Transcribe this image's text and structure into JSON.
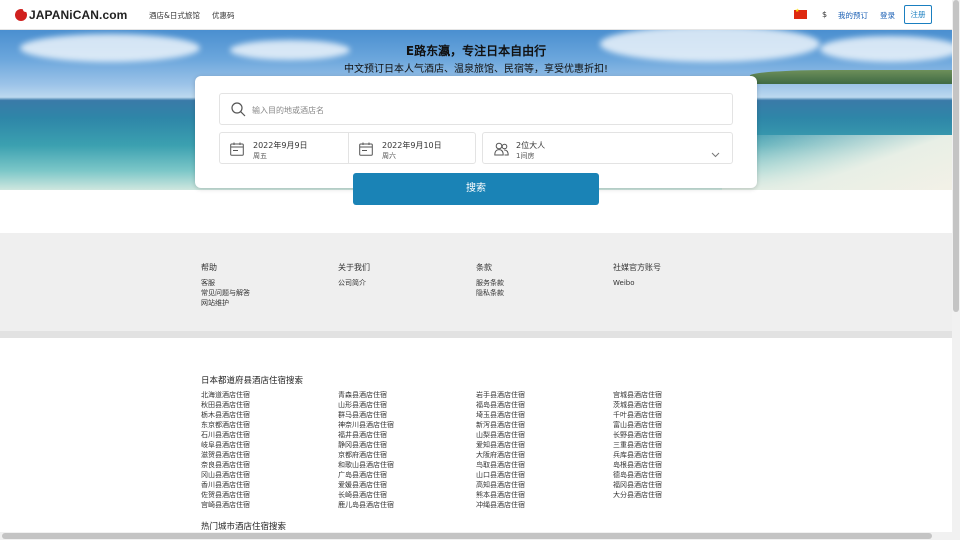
{
  "header": {
    "logo": "JAPANiCAN.com",
    "nav": [
      "酒店&日式旅馆",
      "优惠码"
    ],
    "currency": "$",
    "my_booking": "我的预订",
    "login": "登录",
    "register": "注册"
  },
  "hero": {
    "title": "E路东瀛，专注日本自由行",
    "subtitle": "中文预订日本人气酒店、温泉旅馆、民宿等，享受优惠折扣!"
  },
  "search": {
    "placeholder": "输入目的地或酒店名",
    "checkin_date": "2022年9月9日",
    "checkin_day": "周五",
    "checkout_date": "2022年9月10日",
    "checkout_day": "周六",
    "guests": "2位大人",
    "rooms": "1间房",
    "button": "搜索"
  },
  "footer": {
    "help": {
      "title": "帮助",
      "links": [
        "客服",
        "常见问题与解答",
        "网站维护"
      ]
    },
    "about": {
      "title": "关于我们",
      "links": [
        "公司简介"
      ]
    },
    "terms": {
      "title": "条款",
      "links": [
        "服务条款",
        "隐私条款"
      ]
    },
    "social": {
      "title": "社媒官方账号",
      "links": [
        "Weibo"
      ]
    }
  },
  "prefectures": {
    "title": "日本都道府县酒店住宿搜索",
    "col1": [
      "北海道酒店住宿",
      "秋田县酒店住宿",
      "栃木县酒店住宿",
      "东京都酒店住宿",
      "石川县酒店住宿",
      "岐阜县酒店住宿",
      "滋贺县酒店住宿",
      "奈良县酒店住宿",
      "冈山县酒店住宿",
      "香川县酒店住宿",
      "佐贺县酒店住宿",
      "宫崎县酒店住宿"
    ],
    "col2": [
      "青森县酒店住宿",
      "山形县酒店住宿",
      "群马县酒店住宿",
      "神奈川县酒店住宿",
      "福井县酒店住宿",
      "静冈县酒店住宿",
      "京都府酒店住宿",
      "和歌山县酒店住宿",
      "广岛县酒店住宿",
      "爱媛县酒店住宿",
      "长崎县酒店住宿",
      "鹿儿岛县酒店住宿"
    ],
    "col3": [
      "岩手县酒店住宿",
      "福岛县酒店住宿",
      "埼玉县酒店住宿",
      "新泻县酒店住宿",
      "山梨县酒店住宿",
      "爱知县酒店住宿",
      "大阪府酒店住宿",
      "鸟取县酒店住宿",
      "山口县酒店住宿",
      "高知县酒店住宿",
      "熊本县酒店住宿",
      "冲绳县酒店住宿"
    ],
    "col4": [
      "宫城县酒店住宿",
      "茨城县酒店住宿",
      "千叶县酒店住宿",
      "富山县酒店住宿",
      "长野县酒店住宿",
      "三重县酒店住宿",
      "兵库县酒店住宿",
      "岛根县酒店住宿",
      "德岛县酒店住宿",
      "福冈县酒店住宿",
      "大分县酒店住宿"
    ]
  },
  "cities": {
    "title": "热门城市酒店住宿搜索"
  }
}
